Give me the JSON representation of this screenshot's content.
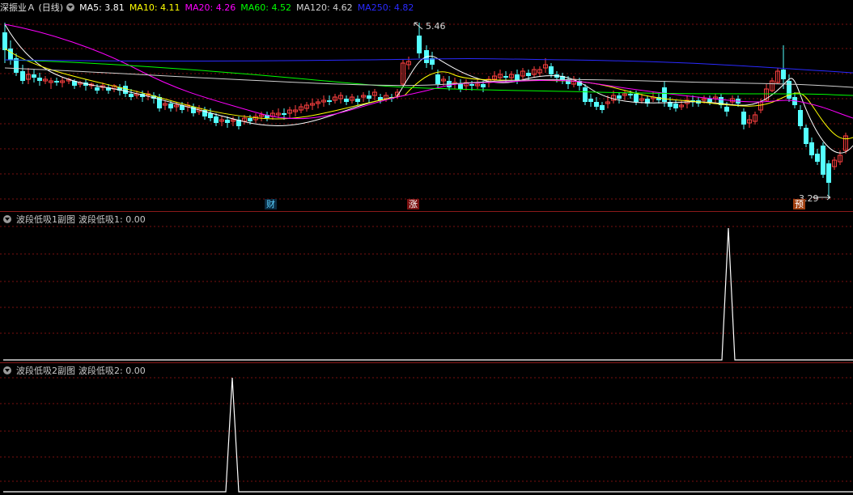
{
  "main": {
    "stock_title": "深振业Ａ (日线)",
    "ma_labels": [
      {
        "text": "MA5: 3.81",
        "color": "#ffffff"
      },
      {
        "text": "MA10: 4.11",
        "color": "#ffff00"
      },
      {
        "text": "MA20: 4.26",
        "color": "#ff00ff"
      },
      {
        "text": "MA60: 4.52",
        "color": "#00ff00"
      },
      {
        "text": "MA120: 4.62",
        "color": "#d0d0d0"
      },
      {
        "text": "MA250: 4.82",
        "color": "#2020ff"
      }
    ],
    "high_label": "5.46",
    "low_label": "3.29",
    "tags": {
      "cai": "财",
      "zhang": "涨",
      "yu": "预"
    }
  },
  "sub1": {
    "name": "波段低吸1副图",
    "value_label": "波段低吸1: 0.00"
  },
  "sub2": {
    "name": "波段低吸2副图",
    "value_label": "波段低吸2: 0.00"
  },
  "colors": {
    "up": "#ff4040",
    "down": "#54ffff",
    "grid": "#7a1010",
    "separator": "#8b1a1a",
    "indicator_line": "#ffffff"
  }
}
